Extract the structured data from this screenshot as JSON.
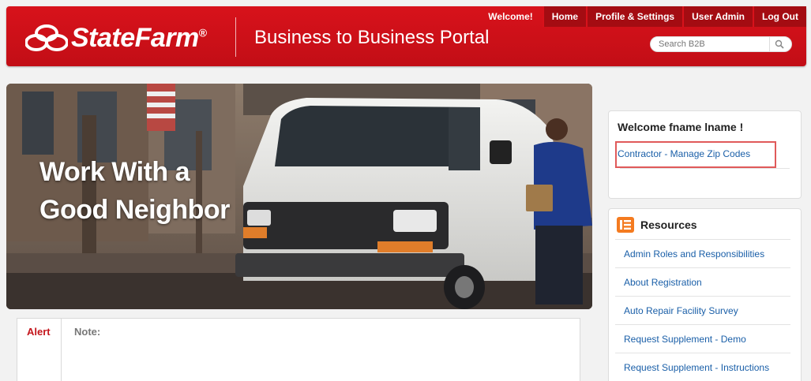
{
  "brand": {
    "name": "StateFarm",
    "registered": "®",
    "portal_title": "Business to Business Portal"
  },
  "topnav": {
    "welcome": "Welcome!",
    "items": [
      "Home",
      "Profile & Settings",
      "User Admin",
      "Log Out"
    ]
  },
  "search": {
    "placeholder": "Search B2B",
    "icon": "search-icon"
  },
  "hero": {
    "line1": "Work With a",
    "line2": "Good Neighbor"
  },
  "alert": {
    "label": "Alert",
    "note": "Note:"
  },
  "welcome_panel": {
    "title": "Welcome fname lname !",
    "link": "Contractor - Manage Zip Codes"
  },
  "resources": {
    "title": "Resources",
    "icon": "resources-list-icon",
    "items": [
      "Admin Roles and Responsibilities",
      "About Registration",
      "Auto Repair Facility Survey",
      "Request Supplement - Demo",
      "Request Supplement - Instructions"
    ]
  },
  "colors": {
    "brand_red": "#d8121b",
    "nav_dark_red": "#a40c12",
    "link_blue": "#1a5fa8",
    "resource_icon": "#f47b20"
  }
}
